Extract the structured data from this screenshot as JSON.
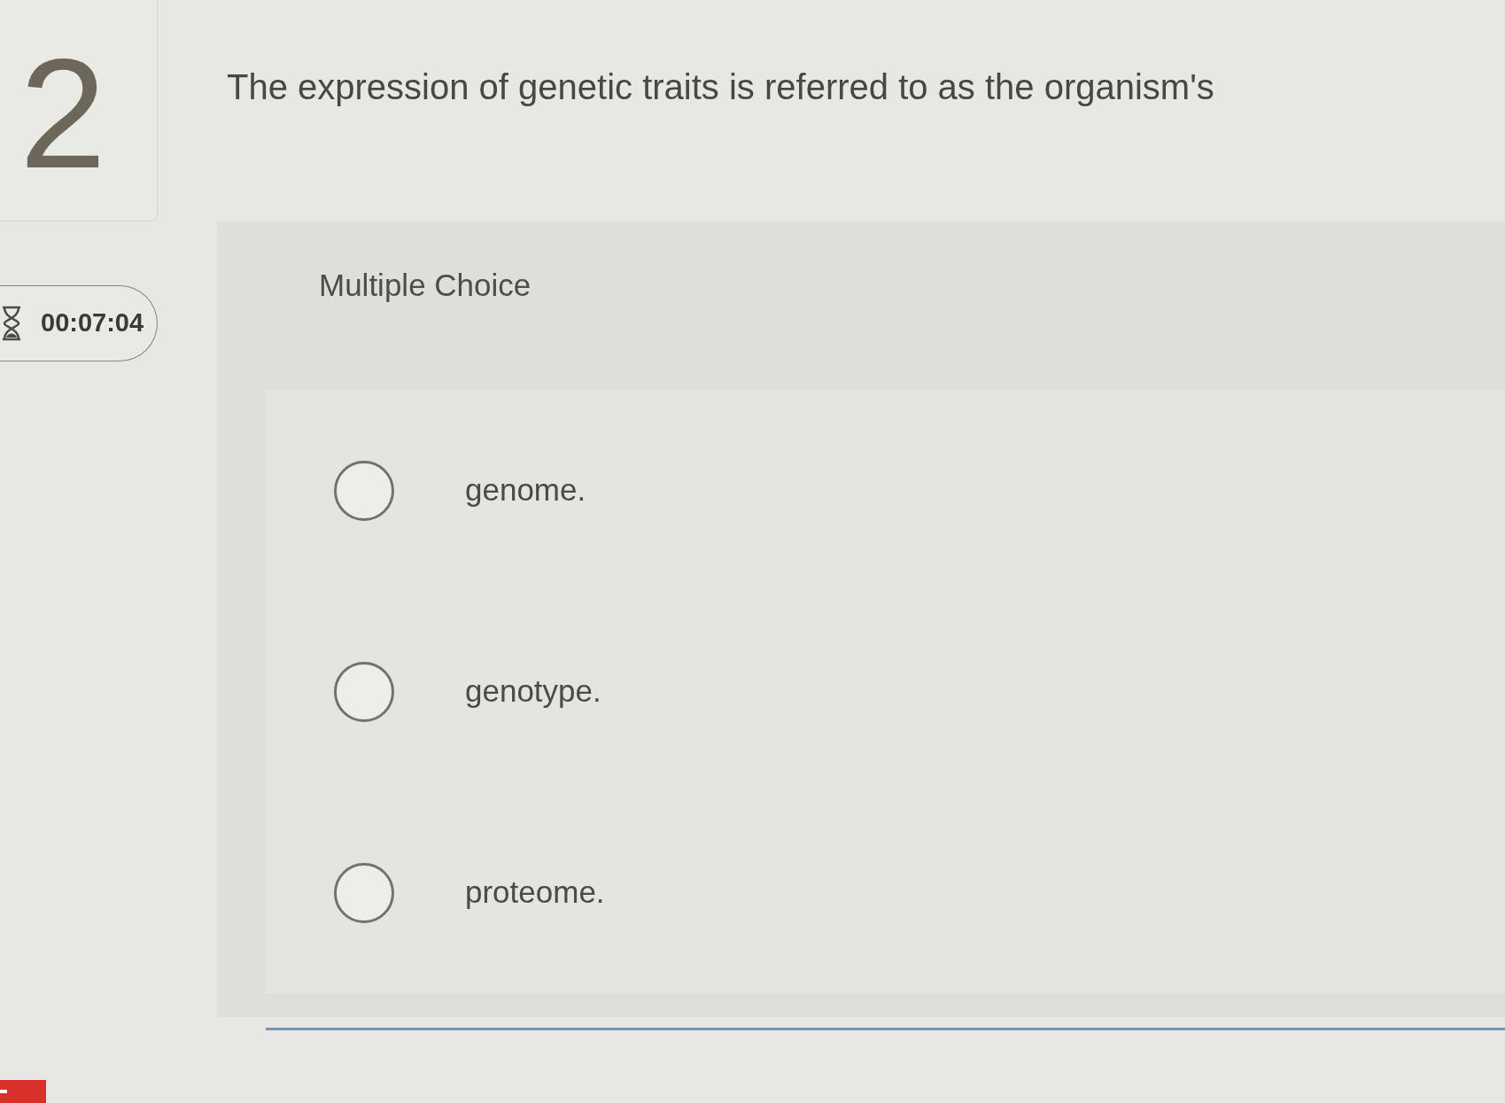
{
  "question": {
    "number": "2",
    "text": "The expression of genetic traits is referred to as the organism's"
  },
  "timer": {
    "time": "00:07:04"
  },
  "answer_panel": {
    "type_label": "Multiple Choice",
    "options": [
      {
        "label": "genome.",
        "selected": false
      },
      {
        "label": "genotype.",
        "selected": false
      },
      {
        "label": "proteome.",
        "selected": false
      }
    ]
  }
}
